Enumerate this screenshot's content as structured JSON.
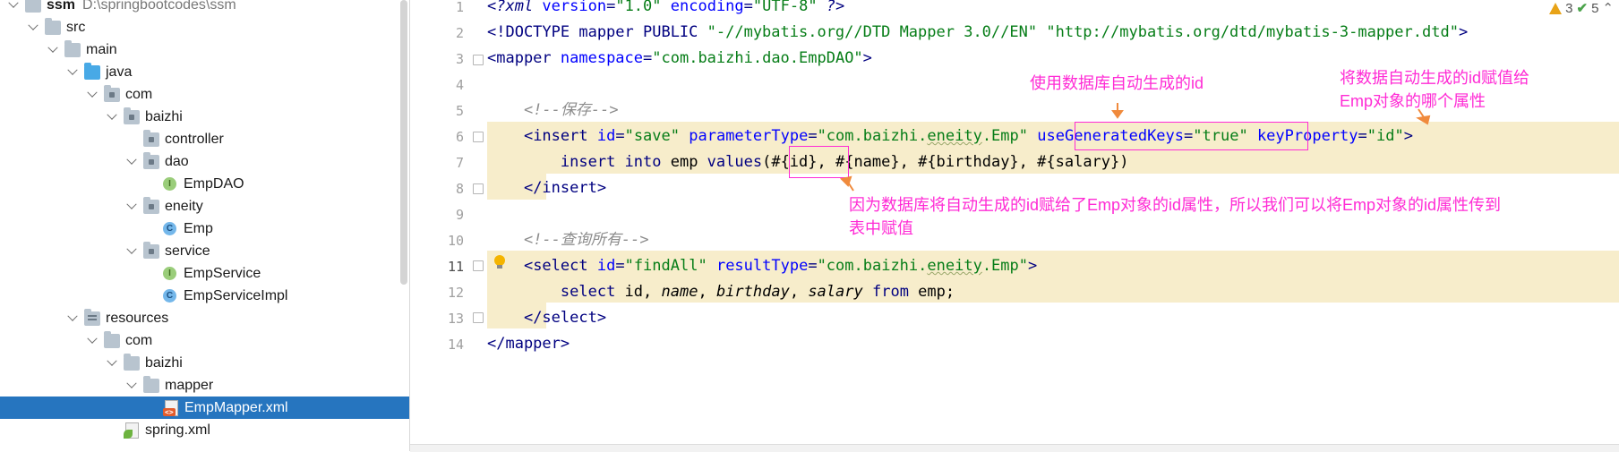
{
  "tree": {
    "rows": [
      {
        "label": "ssm",
        "extra": "D:\\springbootcodes\\ssm",
        "icon": "folder-icon",
        "depth": 0,
        "expanded": true
      },
      {
        "label": "src",
        "icon": "folder-icon",
        "depth": 1,
        "expanded": true
      },
      {
        "label": "main",
        "icon": "folder-icon",
        "depth": 2,
        "expanded": true
      },
      {
        "label": "java",
        "icon": "source-folder-icon",
        "depth": 3,
        "expanded": true
      },
      {
        "label": "com",
        "icon": "package-icon",
        "depth": 4,
        "expanded": true
      },
      {
        "label": "baizhi",
        "icon": "package-icon",
        "depth": 5,
        "expanded": true
      },
      {
        "label": "controller",
        "icon": "package-icon",
        "depth": 6,
        "expanded": false,
        "leaf": true
      },
      {
        "label": "dao",
        "icon": "package-icon",
        "depth": 6,
        "expanded": true
      },
      {
        "label": "EmpDAO",
        "icon": "interface-icon",
        "depth": 7,
        "leaf": true
      },
      {
        "label": "eneity",
        "icon": "package-icon",
        "depth": 6,
        "expanded": true
      },
      {
        "label": "Emp",
        "icon": "class-icon",
        "depth": 7,
        "leaf": true
      },
      {
        "label": "service",
        "icon": "package-icon",
        "depth": 6,
        "expanded": true
      },
      {
        "label": "EmpService",
        "icon": "interface-icon",
        "depth": 7,
        "leaf": true
      },
      {
        "label": "EmpServiceImpl",
        "icon": "class-icon",
        "depth": 7,
        "leaf": true
      },
      {
        "label": "resources",
        "icon": "resources-folder-icon",
        "depth": 3,
        "expanded": true
      },
      {
        "label": "com",
        "icon": "folder-icon",
        "depth": 4,
        "expanded": true
      },
      {
        "label": "baizhi",
        "icon": "folder-icon",
        "depth": 5,
        "expanded": true
      },
      {
        "label": "mapper",
        "icon": "folder-icon",
        "depth": 6,
        "expanded": true
      },
      {
        "label": "EmpMapper.xml",
        "icon": "xml-file-icon",
        "depth": 7,
        "leaf": true,
        "selected": true
      },
      {
        "label": "spring.xml",
        "icon": "spring-xml-icon",
        "depth": 5,
        "leaf": true
      }
    ]
  },
  "editor": {
    "lines": [
      {
        "n": "1",
        "tokens": [
          [
            "pi",
            "<?xml "
          ],
          [
            "an",
            "version"
          ],
          [
            "tg",
            "="
          ],
          [
            "av",
            "\"1.0\""
          ],
          [
            "tg",
            " "
          ],
          [
            "an",
            "encoding"
          ],
          [
            "tg",
            "="
          ],
          [
            "av",
            "\"UTF-8\""
          ],
          [
            "pi",
            " ?>"
          ]
        ]
      },
      {
        "n": "2",
        "tokens": [
          [
            "tg",
            "<!DOCTYPE mapper PUBLIC "
          ],
          [
            "av",
            "\"-//mybatis.org//DTD Mapper 3.0//EN\""
          ],
          [
            "tg",
            " "
          ],
          [
            "av",
            "\"http://mybatis.org/dtd/mybatis-3-mapper.dtd\""
          ],
          [
            "tg",
            ">"
          ]
        ]
      },
      {
        "n": "3",
        "tokens": [
          [
            "tg",
            "<mapper "
          ],
          [
            "an",
            "namespace"
          ],
          [
            "tg",
            "="
          ],
          [
            "av",
            "\"com.baizhi.dao.EmpDAO\""
          ],
          [
            "tg",
            ">"
          ]
        ]
      },
      {
        "n": "4",
        "tokens": []
      },
      {
        "n": "5",
        "tokens": [
          [
            "sp",
            "    "
          ],
          [
            "cm",
            "<!--保存-->"
          ]
        ]
      },
      {
        "n": "6",
        "tokens": [
          [
            "sp",
            "    "
          ],
          [
            "tg",
            "<insert "
          ],
          [
            "an",
            "id"
          ],
          [
            "tg",
            "="
          ],
          [
            "av",
            "\"save\""
          ],
          [
            "tg",
            " "
          ],
          [
            "an",
            "parameterType"
          ],
          [
            "tg",
            "="
          ],
          [
            "av",
            "\"com.baizhi."
          ],
          [
            "avw",
            "eneity"
          ],
          [
            "av",
            ".Emp\""
          ],
          [
            "tg",
            " "
          ],
          [
            "an",
            "useGeneratedKeys"
          ],
          [
            "tg",
            "="
          ],
          [
            "av",
            "\"true\""
          ],
          [
            "tg",
            " "
          ],
          [
            "an",
            "keyProperty"
          ],
          [
            "tg",
            "="
          ],
          [
            "av",
            "\"id\""
          ],
          [
            "tg",
            ">"
          ]
        ]
      },
      {
        "n": "7",
        "tokens": [
          [
            "sp",
            "        "
          ],
          [
            "sqlkw",
            "insert into "
          ],
          [
            "sql",
            "emp "
          ],
          [
            "sqlkw",
            "values"
          ],
          [
            "sql",
            "(#{id}, #{name}, #{birthday}, #{salary})"
          ]
        ]
      },
      {
        "n": "8",
        "tokens": [
          [
            "sp",
            "    "
          ],
          [
            "tg",
            "</insert>"
          ]
        ]
      },
      {
        "n": "9",
        "tokens": []
      },
      {
        "n": "10",
        "tokens": [
          [
            "sp",
            "    "
          ],
          [
            "cm",
            "<!--查询所有-->"
          ]
        ]
      },
      {
        "n": "11",
        "tokens": [
          [
            "sp",
            "    "
          ],
          [
            "tg",
            "<select "
          ],
          [
            "an",
            "id"
          ],
          [
            "tg",
            "="
          ],
          [
            "av",
            "\"findAll\""
          ],
          [
            "tg",
            " "
          ],
          [
            "an",
            "resultType"
          ],
          [
            "tg",
            "="
          ],
          [
            "av",
            "\"com.baizhi."
          ],
          [
            "avw",
            "eneity"
          ],
          [
            "av",
            ".Emp\""
          ],
          [
            "tg",
            ">"
          ]
        ]
      },
      {
        "n": "12",
        "tokens": [
          [
            "sp",
            "        "
          ],
          [
            "sqlkw",
            "select "
          ],
          [
            "sql",
            "id, "
          ],
          [
            "sqlit",
            "name"
          ],
          [
            "sql",
            ", "
          ],
          [
            "sqlit",
            "birthday"
          ],
          [
            "sql",
            ", "
          ],
          [
            "sqlit",
            "salary"
          ],
          [
            "sql",
            " "
          ],
          [
            "sqlkw",
            "from "
          ],
          [
            "sql",
            "emp;"
          ]
        ]
      },
      {
        "n": "13",
        "tokens": [
          [
            "sp",
            "    "
          ],
          [
            "tg",
            "</select>"
          ]
        ]
      },
      {
        "n": "14",
        "tokens": [
          [
            "tg",
            "</mapper>"
          ]
        ]
      }
    ],
    "annotations": {
      "note1": "使用数据库自动生成的id",
      "note2_line1": "将数据自动生成的id赋值给",
      "note2_line2": "Emp对象的哪个属性",
      "note3_line1": "因为数据库将自动生成的id赋给了Emp对象的id属性，所以我们可以将Emp对象的id属性传到",
      "note3_line2": "表中赋值"
    },
    "status": {
      "warnings": "3",
      "ok": "5"
    },
    "colors": {
      "annotation": "#ff2bd5",
      "highlight": "#f7edcb",
      "selection": "#2675bf"
    }
  }
}
